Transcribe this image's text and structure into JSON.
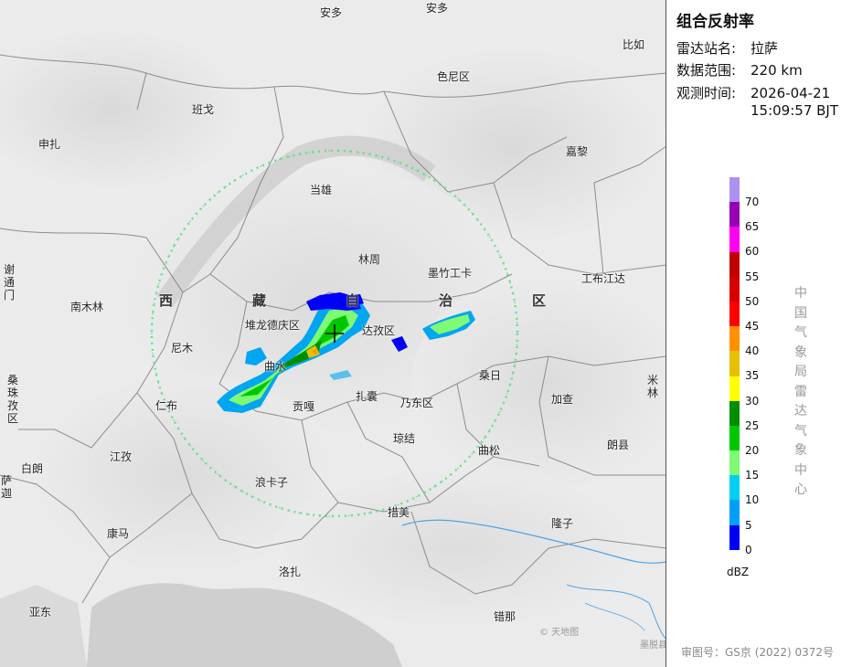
{
  "panel": {
    "title": "组合反射率",
    "station_key": "雷达站名:",
    "station_value": "拉萨",
    "range_key": "数据范围:",
    "range_value": "220 km",
    "time_key": "观测时间:",
    "time_date": "2026-04-21",
    "time_clock": "15:09:57 BJT",
    "agency": "中国气象局雷达气象中心",
    "approval": "审图号：GS京 (2022) 0372号"
  },
  "legend": {
    "unit": "dBZ",
    "ticks": [
      "70",
      "65",
      "60",
      "55",
      "50",
      "45",
      "40",
      "35",
      "30",
      "25",
      "20",
      "15",
      "10",
      "5",
      "0"
    ],
    "colors": [
      "#ad90f0",
      "#9600b4",
      "#ff00f0",
      "#c00000",
      "#d60000",
      "#ff0000",
      "#ff9000",
      "#e7c000",
      "#ffff00",
      "#008e00",
      "#00c800",
      "#7efa74",
      "#01d0f0",
      "#01a0f6",
      "#0000f6"
    ]
  },
  "map": {
    "region_chars": [
      "西",
      "藏",
      "自",
      "治",
      "区"
    ],
    "places": {
      "anduo1": "安多",
      "anduo2": "安多",
      "bijia": "比如",
      "seni": "色尼区",
      "bange": "班戈",
      "shenzha": "申扎",
      "jiali": "嘉黎",
      "dangxiong": "当雄",
      "linzhou": "林周",
      "mozhu": "墨竹工卡",
      "gongbu": "工布江达",
      "xietongmen": "谢通门",
      "nanmulin": "南木林",
      "duilong": "堆龙德庆区",
      "dazi": "达孜区",
      "nimu": "尼木",
      "qushui": "曲水",
      "sangri": "桑日",
      "mili": "米林",
      "sangzhu": "桑珠孜区",
      "renbu": "仁布",
      "gongga": "贡嘎",
      "zhanang": "扎囊",
      "naidong": "乃东区",
      "jiacha": "加查",
      "qiongjie": "琼结",
      "qusong": "曲松",
      "langxian": "朗县",
      "jiangzi": "江孜",
      "bailang": "白朗",
      "sajia": "萨迦",
      "langkazi": "浪卡子",
      "cuomei": "措美",
      "longzi": "隆子",
      "kangma": "康马",
      "luozha": "洛扎",
      "yadong": "亚东",
      "cuona": "错那"
    },
    "watermark1": "© 天地图",
    "watermark2": "墨脱县"
  }
}
